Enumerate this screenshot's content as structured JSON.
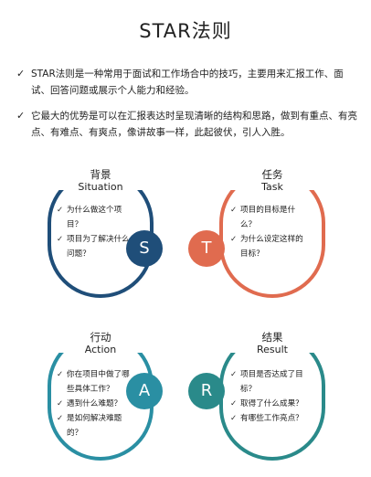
{
  "title": "STAR法则",
  "intro": [
    {
      "text": "STAR法则是一种常用于面试和工作场合中的技巧，主要用来汇报工作、面试、回答问题或展示个人能力和经验。"
    },
    {
      "text": "它最大的优势是可以在汇报表达时呈现清晰的结构和思路，做到有重点、有亮点、有难点、有爽点，像讲故事一样，此起彼伏，引人入胜。"
    }
  ],
  "check_icon": "checkmark",
  "cards": [
    {
      "key": "S",
      "cn": "背景",
      "en": "Situation",
      "color": "#1f4e79",
      "items": [
        "为什么做这个项目？",
        "项目为了解决什么问题？"
      ]
    },
    {
      "key": "T",
      "cn": "任务",
      "en": "Task",
      "color": "#e06b4f",
      "items": [
        "项目的目标是什么？",
        "为什么设定这样的目标？"
      ]
    },
    {
      "key": "A",
      "cn": "行动",
      "en": "Action",
      "color": "#2a8fa3",
      "items": [
        "你在项目中做了哪些具体工作？",
        "遇到什么难题？",
        "是如何解决难题的？"
      ]
    },
    {
      "key": "R",
      "cn": "结果",
      "en": "Result",
      "color": "#2a8a8a",
      "items": [
        "项目是否达成了目标？",
        "取得了什么成果？",
        "有哪些工作亮点？"
      ]
    }
  ]
}
